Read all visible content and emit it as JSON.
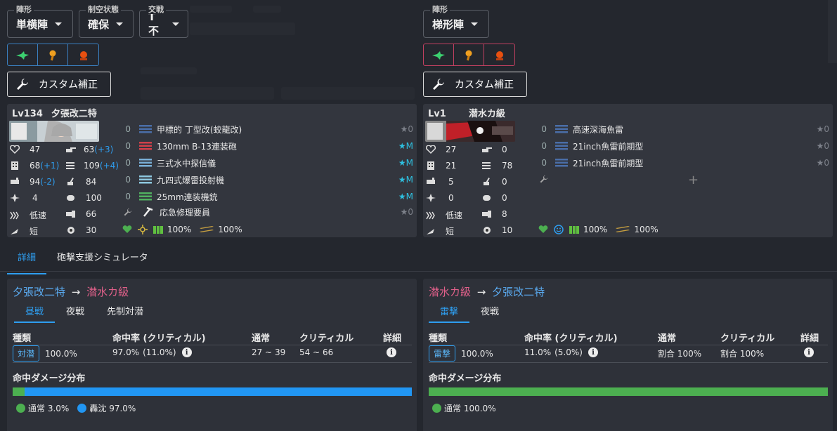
{
  "left": {
    "formation": {
      "label": "陣形",
      "value": "単横陣"
    },
    "air": {
      "label": "制空状態",
      "value": "確保"
    },
    "engagement": {
      "label": "交戦",
      "value": "T不"
    },
    "custom_label": "カスタム補正",
    "ship": {
      "level": "Lv134",
      "name": "夕張改二特",
      "stats": {
        "hp": "47",
        "fire": "63",
        "fire_bonus": "(+3)",
        "armor": "68",
        "armor_bonus": "(+1)",
        "torpedo": "109",
        "torpedo_bonus": "(+4)",
        "evasion": "94",
        "evasion_bonus": "(-2)",
        "aa": "84",
        "aircraft": "4",
        "asw": "100",
        "speed": "低速",
        "los": "66",
        "range": "短",
        "luck": "30"
      },
      "equipment": [
        {
          "slot": "0",
          "name": "甲標的 丁型改(蛟龍改)",
          "prof": "★0",
          "color": "#4a6ea8"
        },
        {
          "slot": "0",
          "name": "130mm B-13連装砲",
          "prof": "★M",
          "color": "#d0404a"
        },
        {
          "slot": "0",
          "name": "三式水中探信儀",
          "prof": "★M",
          "color": "#7ab0d8"
        },
        {
          "slot": "0",
          "name": "九四式爆雷投射機",
          "prof": "★M",
          "color": "#8ec8e0"
        },
        {
          "slot": "0",
          "name": "25mm連装機銃",
          "prof": "★M",
          "color": "#50b060"
        }
      ],
      "expansion": {
        "name": "応急修理要員",
        "prof": "★0"
      },
      "status": {
        "fuel": "100%",
        "ammo": "100%"
      }
    }
  },
  "right": {
    "formation": {
      "label": "陣形",
      "value": "梯形陣"
    },
    "custom_label": "カスタム補正",
    "ship": {
      "level": "Lv1",
      "name": "潜水カ級",
      "stats": {
        "hp": "27",
        "fire": "0",
        "armor": "21",
        "torpedo": "78",
        "evasion": "5",
        "aa": "0",
        "aircraft": "0",
        "asw": "0",
        "speed": "低速",
        "los": "8",
        "range": "短",
        "luck": "10"
      },
      "equipment": [
        {
          "slot": "0",
          "name": "高速深海魚雷",
          "prof": "★0",
          "color": "#4a6ea8"
        },
        {
          "slot": "0",
          "name": "21inch魚雷前期型",
          "prof": "★0",
          "color": "#4a6ea8"
        },
        {
          "slot": "0",
          "name": "21inch魚雷前期型",
          "prof": "★0",
          "color": "#4a6ea8"
        }
      ],
      "status": {
        "fuel": "100%",
        "ammo": "100%"
      }
    }
  },
  "tabs": [
    "詳細",
    "砲撃支援シミュレータ"
  ],
  "panel_left": {
    "attacker": "夕張改二特",
    "arrow": "→",
    "defender": "潜水カ級",
    "subtabs": [
      "昼戦",
      "夜戦",
      "先制対潜"
    ],
    "headers": {
      "type": "種類",
      "hit": "命中率 (クリティカル)",
      "normal": "通常",
      "crit": "クリティカル",
      "detail": "詳細"
    },
    "row": {
      "tag": "対潜",
      "rate": "100.0%",
      "hit": "97.0%",
      "crit_rate": "(11.0%)",
      "normal": "27 ~ 39",
      "crit": "54 ~ 66"
    },
    "dist_label": "命中ダメージ分布",
    "dist": [
      {
        "label": "通常",
        "pct": "3.0%",
        "value": 3.0,
        "color": "#4caf50"
      },
      {
        "label": "轟沈",
        "pct": "97.0%",
        "value": 97.0,
        "color": "#2196f3"
      }
    ]
  },
  "panel_right": {
    "attacker": "潜水カ級",
    "arrow": "→",
    "defender": "夕張改二特",
    "subtabs": [
      "雷撃",
      "夜戦"
    ],
    "headers": {
      "type": "種類",
      "hit": "命中率 (クリティカル)",
      "normal": "通常",
      "crit": "クリティカル",
      "detail": "詳細"
    },
    "row": {
      "tag": "雷撃",
      "rate": "100.0%",
      "hit": "11.0%",
      "crit_rate": "(5.0%)",
      "normal": "割合 100%",
      "crit": "割合 100%"
    },
    "dist_label": "命中ダメージ分布",
    "dist": [
      {
        "label": "通常",
        "pct": "100.0%",
        "value": 100.0,
        "color": "#4caf50"
      }
    ]
  }
}
